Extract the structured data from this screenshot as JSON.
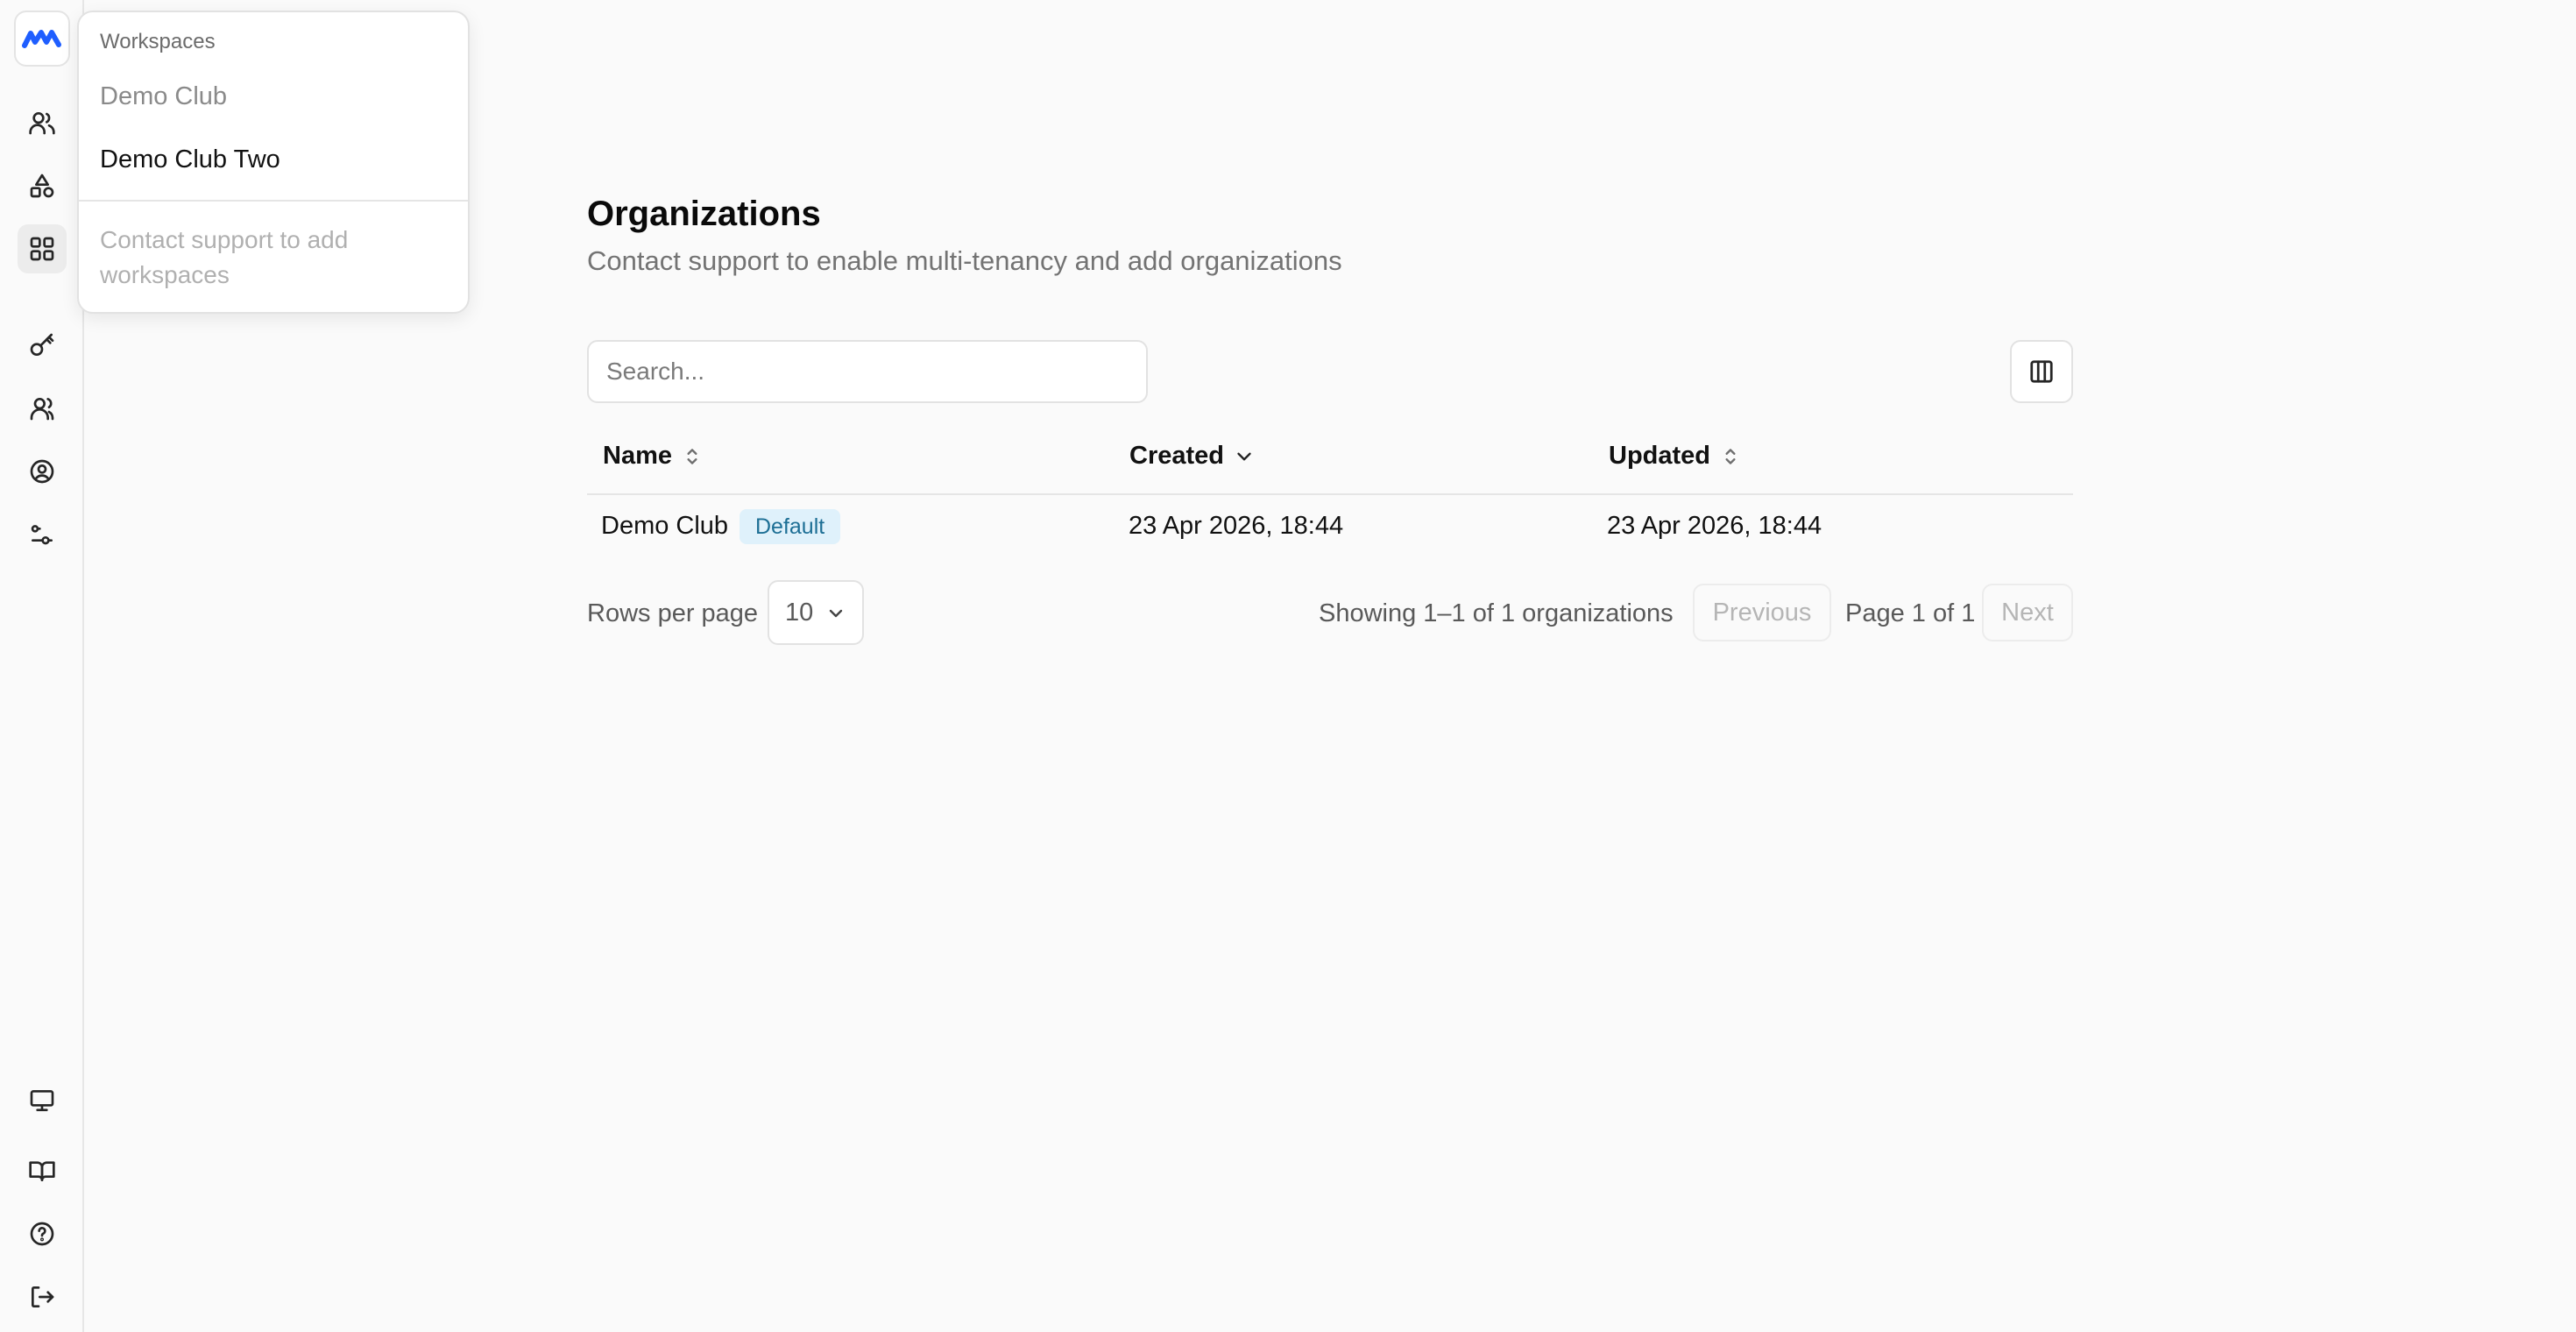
{
  "sidebar": {
    "logo_icon": "app-logo",
    "items": [
      {
        "name": "users-icon"
      },
      {
        "name": "shapes-icon"
      },
      {
        "name": "grid-icon",
        "active": true
      },
      {
        "name": "key-icon"
      },
      {
        "name": "team-icon"
      },
      {
        "name": "user-circle-icon"
      },
      {
        "name": "settings-sliders-icon"
      }
    ],
    "bottom_items": [
      {
        "name": "monitor-icon"
      },
      {
        "name": "book-icon"
      },
      {
        "name": "help-icon"
      },
      {
        "name": "logout-icon"
      }
    ]
  },
  "workspaces_menu": {
    "heading": "Workspaces",
    "items": [
      "Demo Club",
      "Demo Club Two"
    ],
    "note": "Contact support to add workspaces"
  },
  "page": {
    "title": "Organizations",
    "subtitle": "Contact support to enable multi-tenancy and add organizations"
  },
  "search": {
    "placeholder": "Search...",
    "value": ""
  },
  "table": {
    "columns": [
      "Name",
      "Created",
      "Updated"
    ],
    "rows": [
      {
        "name": "Demo Club",
        "badge": "Default",
        "created": "23 Apr 2026, 18:44",
        "updated": "23 Apr 2026, 18:44"
      }
    ]
  },
  "pagination": {
    "rows_label": "Rows per page",
    "rows_value": "10",
    "showing": "Showing 1–1 of 1 organizations",
    "previous": "Previous",
    "page_info": "Page 1 of 1",
    "next": "Next"
  },
  "colors": {
    "brand": "#1f5eff",
    "badge_bg": "#dff1fb",
    "badge_text": "#1d6f95"
  }
}
